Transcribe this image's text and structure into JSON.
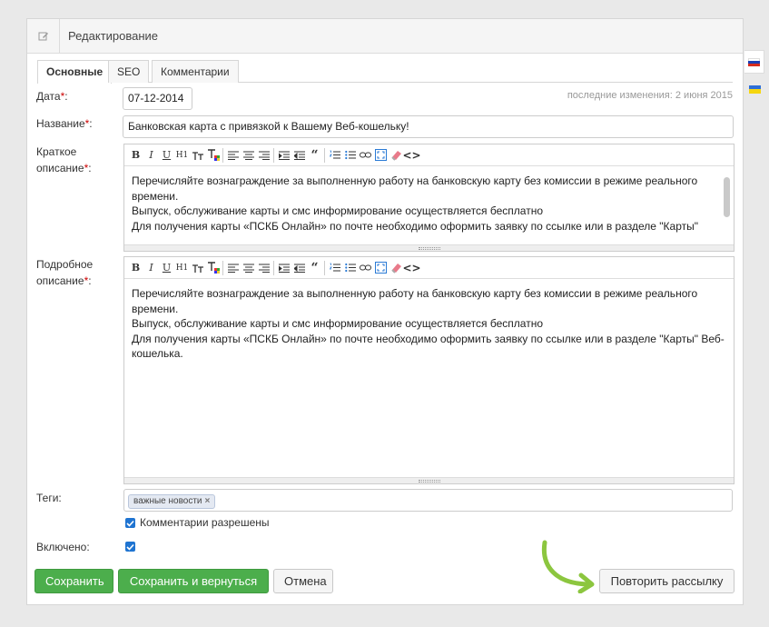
{
  "header": {
    "title": "Редактирование",
    "icon": "edit-icon"
  },
  "tabs": [
    {
      "label": "Основные",
      "active": true
    },
    {
      "label": "SEO",
      "active": false
    },
    {
      "label": "Комментарии",
      "active": false
    }
  ],
  "form": {
    "date_label": "Дата",
    "date_value": "07-12-2014",
    "last_change": "последние изменения: 2 июня 2015",
    "name_label": "Название",
    "name_value": "Банковская карта с привязкой к Вашему Веб-кошельку!",
    "short_label_1": "Краткое",
    "short_label_2": "описание",
    "full_label_1": "Подробное",
    "full_label_2": "описание",
    "required_mark": "*",
    "colon": ":",
    "tags_label": "Теги:",
    "enabled_label": "Включено:"
  },
  "short_editor": {
    "lines": [
      "Перечисляйте вознаграждение за выполненную работу на банковскую карту без комиссии в режиме реального",
      "времени.",
      "Выпуск, обслуживание карты и смс информирование осуществляется бесплатно",
      "Для получения карты «ПСКБ Онлайн» по почте необходимо оформить заявку по ссылке или в разделе \"Карты\""
    ]
  },
  "full_editor": {
    "lines": [
      "Перечисляйте вознаграждение за выполненную работу на банковскую карту без комиссии в режиме реального",
      "времени.",
      "Выпуск, обслуживание карты и смс информирование осуществляется бесплатно",
      "Для получения карты «ПСКБ Онлайн» по почте необходимо оформить заявку по ссылке или в разделе \"Карты\" Веб-",
      "кошелька."
    ]
  },
  "toolbar": {
    "bold": "B",
    "italic": "I",
    "underline": "U",
    "heading": "H1",
    "quote": "“",
    "tools": [
      "bold-icon",
      "italic-icon",
      "underline-icon",
      "heading-icon",
      "font-size-icon",
      "text-color-icon",
      "align-left-icon",
      "align-center-icon",
      "align-right-icon",
      "indent-icon",
      "outdent-icon",
      "blockquote-icon",
      "ordered-list-icon",
      "unordered-list-icon",
      "link-icon",
      "fullscreen-icon",
      "eraser-icon",
      "source-code-icon"
    ]
  },
  "tags": [
    {
      "label": "важные новости",
      "remove": "×"
    }
  ],
  "comments_allowed": {
    "label": "Комментарии разрешены",
    "checked": true
  },
  "enabled": {
    "checked": true
  },
  "buttons": {
    "save": "Сохранить",
    "save_return": "Сохранить и вернуться",
    "cancel": "Отмена",
    "repeat": "Повторить рассылку"
  },
  "languages": [
    {
      "name": "ru-flag-icon",
      "active": true,
      "colors": [
        "#ffffff",
        "#1c3fb5",
        "#d52b1e"
      ]
    },
    {
      "name": "ua-flag-icon",
      "active": false,
      "colors": [
        "#2e6fd8",
        "#f5d60f"
      ]
    }
  ],
  "colors": {
    "accent_green": "#4cae4c",
    "arrow_green": "#8cc63f",
    "checkbox": "#1f74d1"
  }
}
